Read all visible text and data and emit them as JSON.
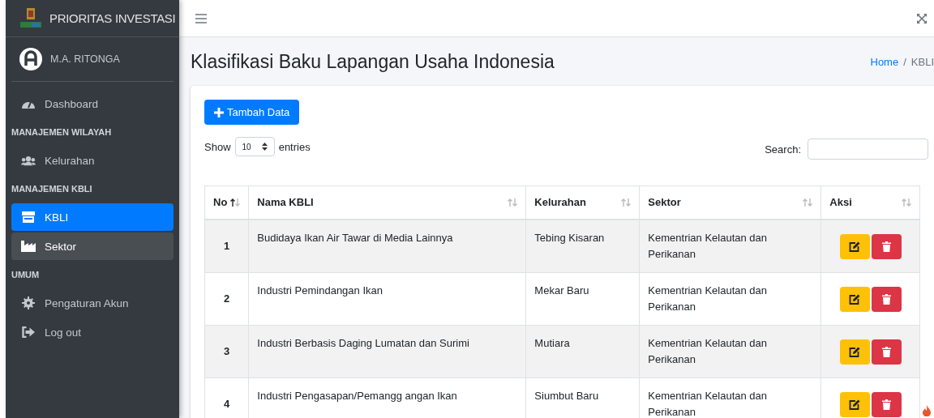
{
  "brand": {
    "title": "PRIORITAS INVESTASI"
  },
  "user": {
    "name": "M.A. RITONGA"
  },
  "sidebar": {
    "items": [
      {
        "kind": "link",
        "label": "Dashboard",
        "selected": false,
        "hovered": false
      },
      {
        "kind": "heading",
        "label": "MANAJEMEN WILAYAH"
      },
      {
        "kind": "link",
        "label": "Kelurahan",
        "selected": false,
        "hovered": false
      },
      {
        "kind": "heading",
        "label": "MANAJEMEN KBLI"
      },
      {
        "kind": "link",
        "label": "KBLI",
        "selected": true,
        "hovered": false
      },
      {
        "kind": "link",
        "label": "Sektor",
        "selected": false,
        "hovered": true
      },
      {
        "kind": "heading",
        "label": "UMUM"
      },
      {
        "kind": "link",
        "label": "Pengaturan Akun",
        "selected": false,
        "hovered": false
      },
      {
        "kind": "link",
        "label": "Log out",
        "selected": false,
        "hovered": false
      }
    ]
  },
  "page": {
    "title": "Klasifikasi Baku Lapangan Usaha Indonesia",
    "breadcrumb_separator": "/",
    "breadcrumb": [
      {
        "label": "Home",
        "link": true
      },
      {
        "label": "KBLI",
        "link": false
      }
    ]
  },
  "toolbar": {
    "add_button": "Tambah Data",
    "show_label": "Show",
    "entries_value": "10",
    "entries_label": "entries",
    "search_label": "Search:"
  },
  "table": {
    "columns": [
      {
        "label": "No",
        "sorted": true
      },
      {
        "label": "Nama KBLI",
        "sorted": false
      },
      {
        "label": "Kelurahan",
        "sorted": false
      },
      {
        "label": "Sektor",
        "sorted": false
      },
      {
        "label": "Aksi",
        "sorted": false
      }
    ],
    "rows": [
      {
        "no": "1",
        "nama": "Budidaya Ikan Air Tawar di Media Lainnya",
        "kelurahan": "Tebing Kisaran",
        "sektor": "Kementrian Kelautan dan Perikanan"
      },
      {
        "no": "2",
        "nama": "Industri Pemindangan Ikan",
        "kelurahan": "Mekar Baru",
        "sektor": "Kementrian Kelautan dan Perikanan"
      },
      {
        "no": "3",
        "nama": "Industri Berbasis Daging Lumatan dan Surimi",
        "kelurahan": "Mutiara",
        "sektor": "Kementrian Kelautan dan Perikanan"
      },
      {
        "no": "4",
        "nama": "Industri Pengasapan/Pemangg angan Ikan",
        "kelurahan": "Siumbut Baru",
        "sektor": "Kementrian Kelautan dan Perikanan"
      }
    ]
  }
}
